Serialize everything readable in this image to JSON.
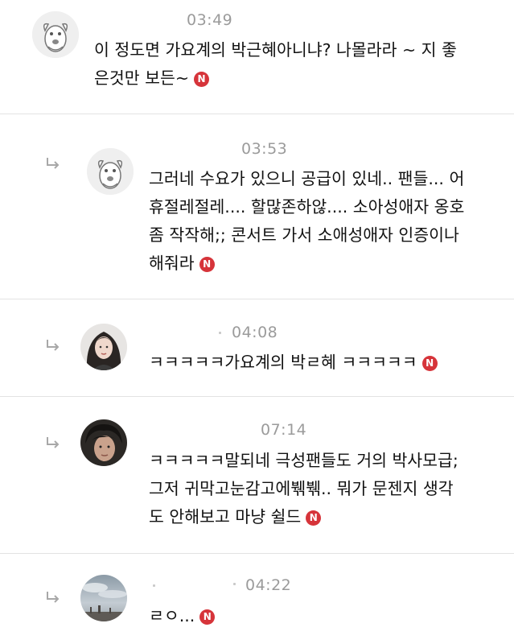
{
  "comments": [
    {
      "time": "03:49",
      "text": [
        "이 정도면 가요계의 박근혜아니냐? 나몰라라 ~ 지 좋",
        "은것만 보든~"
      ],
      "avatar": "cartoon-dog-avatar",
      "badge": "N"
    },
    {
      "time": "03:53",
      "text": [
        "그러네 수요가 있으니 공급이 있네.. 팬들... 어",
        "휴절레절레.... 할많존하않.... 소아성애자 옹호",
        "좀 작작해;; 콘서트 가서 소애성애자 인증이나",
        "해줘라"
      ],
      "avatar": "cartoon-dog-avatar",
      "badge": "N"
    },
    {
      "time": "04:08",
      "text": [
        "ㅋㅋㅋㅋㅋ가요계의 박ㄹ혜 ㅋㅋㅋㅋㅋ"
      ],
      "avatar": "woman-portrait-avatar",
      "badge": "N"
    },
    {
      "time": "07:14",
      "text": [
        "ㅋㅋㅋㅋㅋ말되네 극성팬들도 거의 박사모급;",
        "그저 귀막고눈감고에붺붺.. 뭐가 문젠지 생각",
        "도 안해보고 마냥 쉴드"
      ],
      "avatar": "dark-portrait-avatar",
      "badge": "N"
    },
    {
      "time": "04:22",
      "text": [
        "ㄹㅇ..."
      ],
      "avatar": "sky-photo-avatar",
      "badge": "N"
    }
  ],
  "colors": {
    "badge": "#d6343a",
    "time": "#9b9b9b",
    "divider": "#e3e3e3"
  }
}
